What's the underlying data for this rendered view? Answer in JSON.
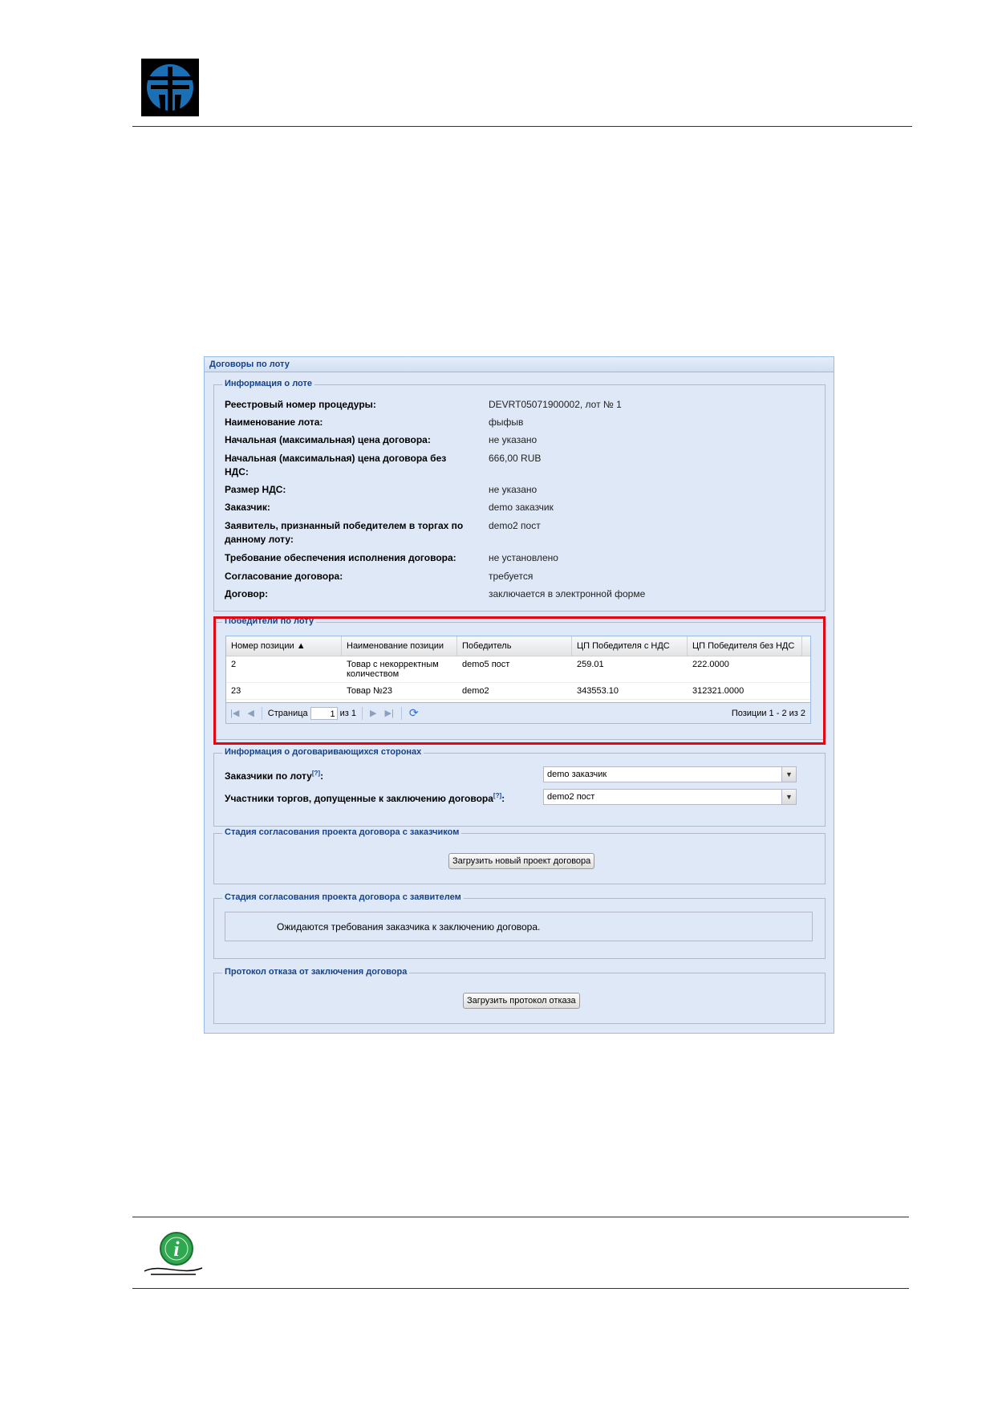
{
  "logo": {
    "icon": "company-logo-icon",
    "color": "#1a6fb5"
  },
  "window": {
    "title": "Договоры по лоту",
    "lot_info": {
      "legend": "Информация о лоте",
      "rows": [
        {
          "label": "Реестровый номер процедуры:",
          "value": "DEVRT05071900002, лот № 1"
        },
        {
          "label": "Наименование лота:",
          "value": "фыфыв"
        },
        {
          "label": "Начальная (максимальная) цена договора:",
          "value": "не указано"
        },
        {
          "label": "Начальная (максимальная) цена договора без НДС:",
          "value": "666,00 RUB"
        },
        {
          "label": "Размер НДС:",
          "value": "не указано"
        },
        {
          "label": "Заказчик:",
          "value": "demo заказчик"
        },
        {
          "label": "Заявитель, признанный победителем в торгах по данному лоту:",
          "value": "demo2 пост"
        },
        {
          "label": "Требование обеспечения исполнения договора:",
          "value": "не установлено"
        },
        {
          "label": "Согласование договора:",
          "value": "требуется"
        },
        {
          "label": "Договор:",
          "value": "заключается в электронной форме"
        }
      ]
    },
    "winners": {
      "legend": "Победители по лоту",
      "columns": [
        "Номер позиции ▲",
        "Наименование позиции",
        "Победитель",
        "ЦП Победителя с НДС",
        "ЦП Победителя без НДС"
      ],
      "rows": [
        [
          "2",
          "Товар с некорректным количеством",
          "demo5 пост",
          "259.01",
          "222.0000"
        ],
        [
          "23",
          "Товар №23",
          "demo2",
          "343553.10",
          "312321.0000"
        ]
      ],
      "pager": {
        "page_label": "Страница",
        "page": "1",
        "of_label": "из 1",
        "summary": "Позиции 1 - 2 из 2"
      }
    },
    "parties": {
      "legend": "Информация о договаривающихся сторонах",
      "customers_label": "Заказчики по лоту",
      "customers_value": "demo заказчик",
      "participants_label": "Участники торгов, допущенные к заключению договора",
      "participants_value": "demo2 пост",
      "help_mark": "[?]"
    },
    "customer_stage": {
      "legend": "Стадия согласования проекта договора с заказчиком",
      "button": "Загрузить новый проект договора"
    },
    "applicant_stage": {
      "legend": "Стадия согласования проекта договора с заявителем",
      "notice": "Ожидаются требования заказчика к заключению договора."
    },
    "refusal": {
      "legend": "Протокол отказа от заключения договора",
      "button": "Загрузить протокол отказа"
    }
  },
  "highlight_color": "#e30613",
  "info_icon": {
    "icon": "info-icon",
    "color": "#2fa84f"
  }
}
